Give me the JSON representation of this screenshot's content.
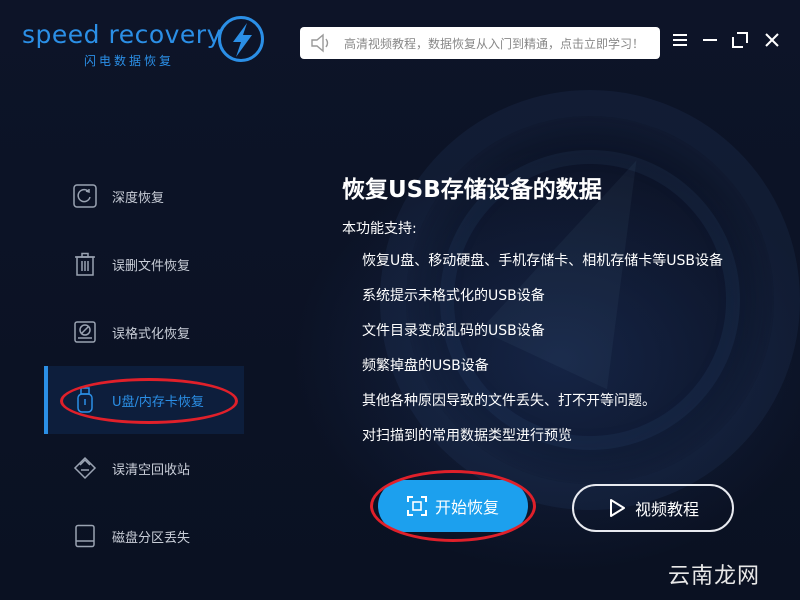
{
  "app": {
    "logo_text": "speed recovery",
    "logo_sub": "闪电数据恢复"
  },
  "notice": {
    "text": "高清视频教程，数据恢复从入门到精通，点击立即学习！"
  },
  "sidebar": {
    "items": [
      {
        "label": "深度恢复",
        "icon": "refresh-circle-icon"
      },
      {
        "label": "误删文件恢复",
        "icon": "trash-icon"
      },
      {
        "label": "误格式化恢复",
        "icon": "disk-format-icon"
      },
      {
        "label": "U盘/内存卡恢复",
        "icon": "usb-drive-icon",
        "active": true
      },
      {
        "label": "误清空回收站",
        "icon": "recycle-bin-icon"
      },
      {
        "label": "磁盘分区丢失",
        "icon": "partition-icon"
      }
    ]
  },
  "main": {
    "title": "恢复USB存储设备的数据",
    "subtitle": "本功能支持:",
    "features": [
      "恢复U盘、移动硬盘、手机存储卡、相机存储卡等USB设备",
      "系统提示未格式化的USB设备",
      "文件目录变成乱码的USB设备",
      "频繁掉盘的USB设备",
      "其他各种原因导致的文件丢失、打不开等问题。",
      "对扫描到的常用数据类型进行预览"
    ],
    "start_label": "开始恢复",
    "video_label": "视频教程"
  },
  "watermark": "云南龙网",
  "colors": {
    "accent": "#2b8fe6",
    "button": "#1ca0ee",
    "annotation": "#e0202a",
    "background": "#0b1224"
  }
}
